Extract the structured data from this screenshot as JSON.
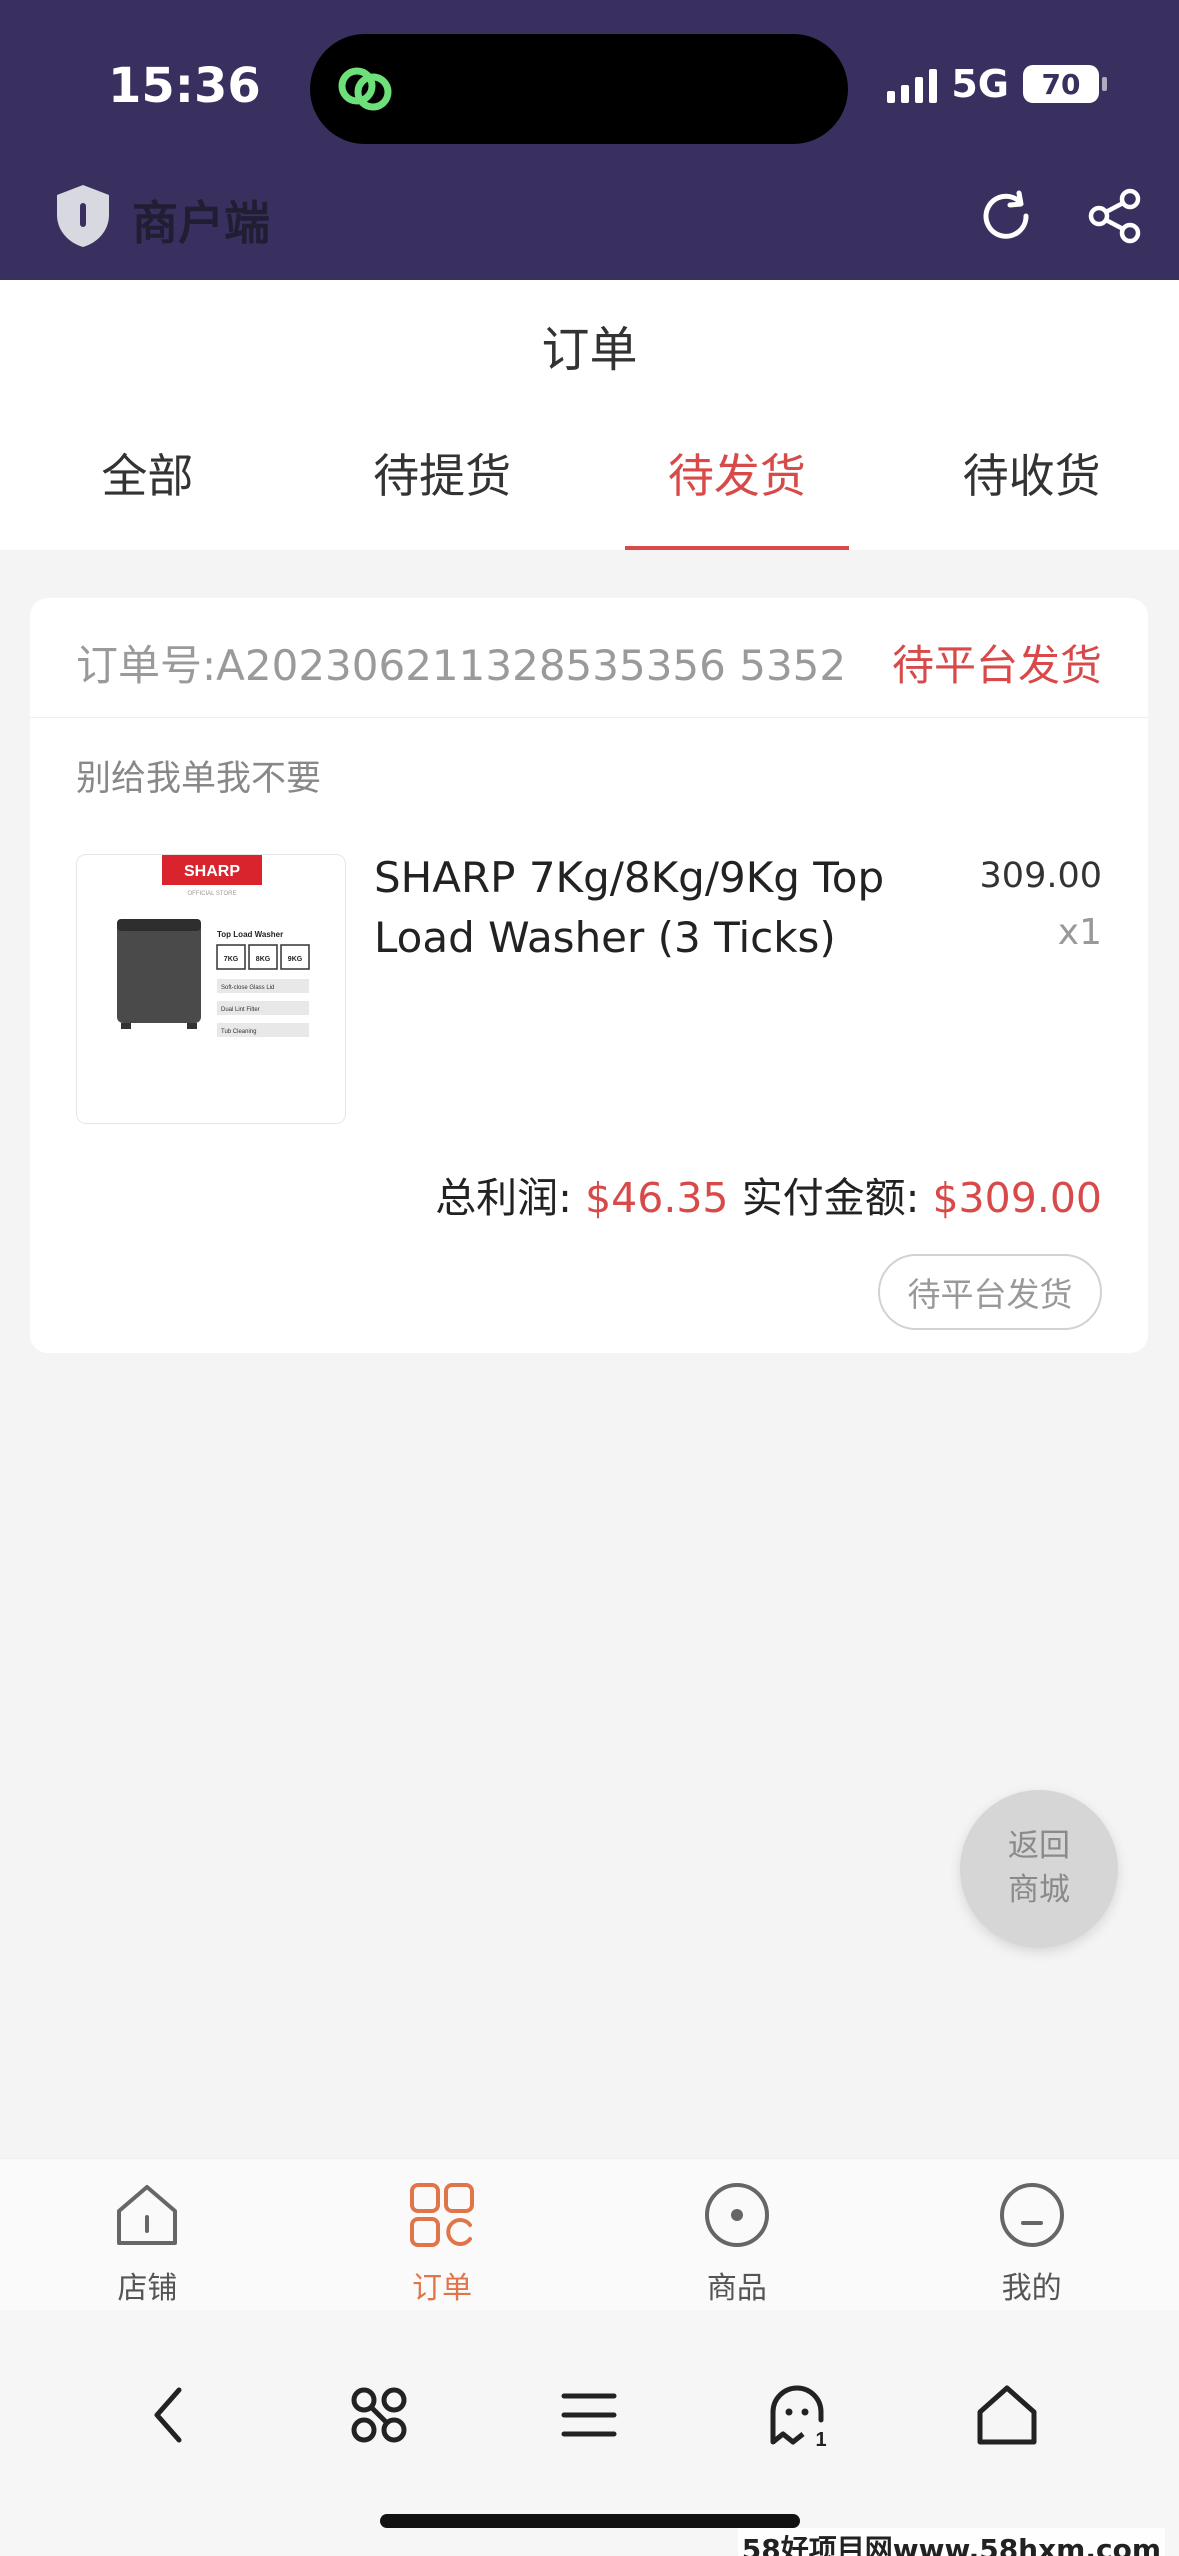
{
  "status_bar": {
    "time": "15:36",
    "network": "5G",
    "battery": "70"
  },
  "app_header": {
    "title": "商户端"
  },
  "page": {
    "title": "订单"
  },
  "tabs": [
    {
      "label": "全部",
      "active": false
    },
    {
      "label": "待提货",
      "active": false
    },
    {
      "label": "待发货",
      "active": true
    },
    {
      "label": "待收货",
      "active": false
    }
  ],
  "order": {
    "order_no": "订单号:A202306211328535356 5352",
    "status": "待平台发货",
    "note": "别给我单我不要",
    "product": {
      "name": "SHARP 7Kg/8Kg/9Kg Top Load Washer (3 Ticks)",
      "price": "309.00",
      "qty": "x1",
      "image": {
        "brand": "SHARP",
        "store": "OFFICIAL STORE",
        "heading": "Top Load Washer",
        "sizes": [
          "7KG",
          "8KG",
          "9KG"
        ],
        "features": [
          "Soft-close Glass Lid",
          "Dual Lint Filter",
          "Tub Cleaning"
        ]
      }
    },
    "profit_label": "总利润:",
    "profit_value": "$46.35",
    "paid_label": "实付金额:",
    "paid_value": "$309.00",
    "action_button": "待平台发货"
  },
  "float_button": {
    "line1": "返回",
    "line2": "商城"
  },
  "bottom_nav": [
    {
      "label": "店铺",
      "icon": "store-icon",
      "active": false
    },
    {
      "label": "订单",
      "icon": "orders-icon",
      "active": true
    },
    {
      "label": "商品",
      "icon": "products-icon",
      "active": false
    },
    {
      "label": "我的",
      "icon": "profile-icon",
      "active": false
    }
  ],
  "watermark": "58好项目网www.58hxm.com",
  "colors": {
    "header": "#39305f",
    "accent": "#d84a4a",
    "nav_active": "#e0754a"
  }
}
